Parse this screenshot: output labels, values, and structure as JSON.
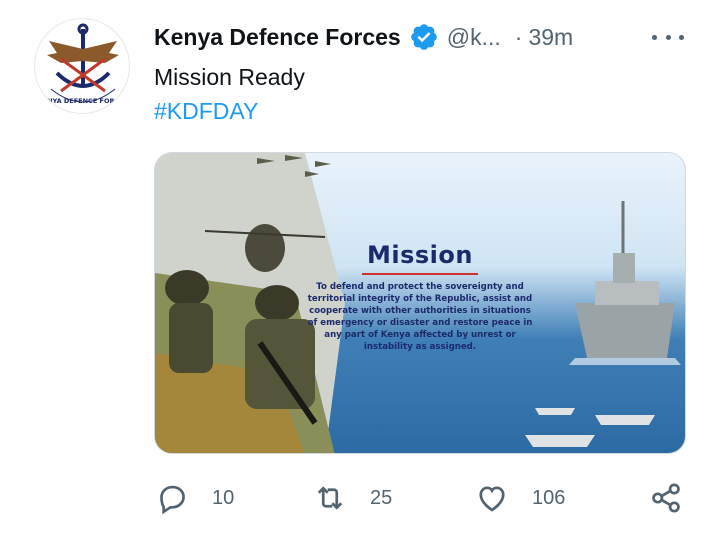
{
  "tweet": {
    "author_name": "Kenya Defence Forces",
    "handle": "@k...",
    "separator": "·",
    "time": "39m",
    "text": "Mission Ready",
    "hashtag": "#KDFDAY"
  },
  "avatar": {
    "logo_text": "KENYA DEFENCE FORCES"
  },
  "media": {
    "title": "Mission",
    "body": "To defend and protect the sovereignty and territorial integrity of the Republic, assist and cooperate with other authorities in situations of emergency or disaster and restore peace in any part of Kenya affected by unrest or instability as assigned."
  },
  "actions": {
    "replies": "10",
    "retweets": "25",
    "likes": "106"
  },
  "colors": {
    "link": "#1d9bf0",
    "verified": "#1d9bf0",
    "muted": "#536471",
    "mission_text": "#1c2a6b"
  },
  "icons": [
    "kdf-logo-icon",
    "verified-badge-icon",
    "more-icon",
    "reply-icon",
    "retweet-icon",
    "like-icon",
    "share-icon"
  ]
}
